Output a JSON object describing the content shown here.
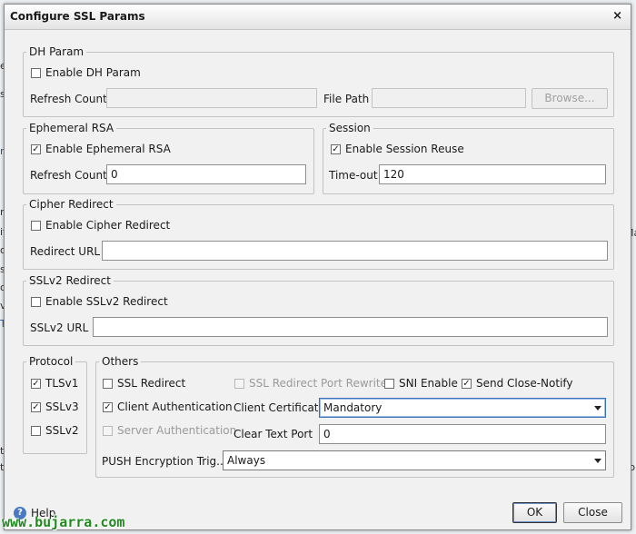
{
  "dialog": {
    "title": "Configure SSL Params",
    "close_glyph": "×"
  },
  "dh_param": {
    "legend": "DH Param",
    "enable_label": "Enable DH Param",
    "enable_checked": false,
    "refresh_count_label": "Refresh Count",
    "refresh_count_value": "",
    "file_path_label": "File Path",
    "file_path_value": "",
    "browse_label": "Browse..."
  },
  "ephemeral_rsa": {
    "legend": "Ephemeral RSA",
    "enable_label": "Enable Ephemeral RSA",
    "enable_checked": true,
    "refresh_count_label": "Refresh Count",
    "refresh_count_value": "0"
  },
  "session": {
    "legend": "Session",
    "enable_label": "Enable Session Reuse",
    "enable_checked": true,
    "timeout_label": "Time-out",
    "timeout_value": "120"
  },
  "cipher_redirect": {
    "legend": "Cipher Redirect",
    "enable_label": "Enable Cipher Redirect",
    "enable_checked": false,
    "url_label": "Redirect URL",
    "url_value": ""
  },
  "sslv2_redirect": {
    "legend": "SSLv2 Redirect",
    "enable_label": "Enable SSLv2 Redirect",
    "enable_checked": false,
    "url_label": "SSLv2 URL",
    "url_value": ""
  },
  "protocol": {
    "legend": "Protocol",
    "items": [
      {
        "label": "TLSv1",
        "checked": true
      },
      {
        "label": "SSLv3",
        "checked": true
      },
      {
        "label": "SSLv2",
        "checked": false
      }
    ]
  },
  "others": {
    "legend": "Others",
    "ssl_redirect_label": "SSL Redirect",
    "ssl_redirect_checked": false,
    "ssl_redirect_port_rewrite_label": "SSL Redirect Port Rewrite",
    "sni_enable_label": "SNI Enable",
    "sni_enable_checked": false,
    "send_close_notify_label": "Send Close-Notify",
    "send_close_notify_checked": true,
    "client_auth_label": "Client Authentication",
    "client_auth_checked": true,
    "server_auth_label": "Server Authentication",
    "client_certificate_label": "Client Certificate",
    "client_certificate_value": "Mandatory",
    "clear_text_port_label": "Clear Text Port",
    "clear_text_port_value": "0",
    "push_encryption_label": "PUSH Encryption Trig...",
    "push_encryption_value": "Always"
  },
  "footer": {
    "help_label": "Help",
    "ok_label": "OK",
    "close_label": "Close"
  },
  "watermark": "www.bujarra.com",
  "check_glyph": "✓",
  "background": {
    "left_fragments": [
      "e",
      "s",
      "n",
      "rt",
      "it",
      "or",
      "s",
      "or",
      "v",
      "T",
      "ti",
      "to"
    ],
    "right_fragments": [
      "Ma",
      "ti",
      "to"
    ]
  }
}
